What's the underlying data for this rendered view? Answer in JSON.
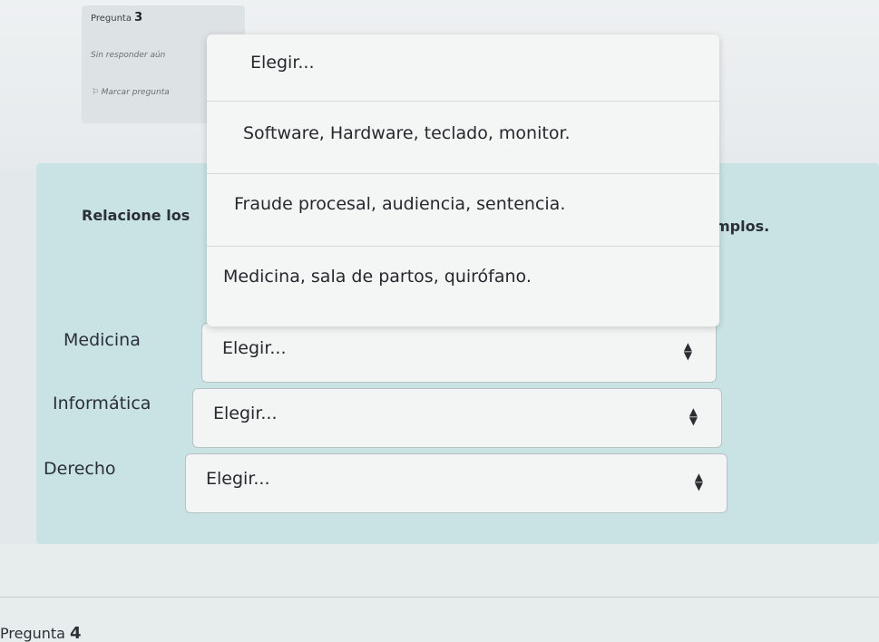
{
  "question_info": {
    "label": "Pregunta",
    "number": "3",
    "status": "Sin responder aún",
    "flag": "Marcar pregunta"
  },
  "prompt": {
    "left_text": "Relacione los",
    "right_text": "mplos."
  },
  "dropdown": {
    "options": [
      "Elegir...",
      "Software, Hardware, teclado, monitor.",
      "Fraude procesal, audiencia, sentencia.",
      "Medicina, sala de partos, quirófano."
    ]
  },
  "matches": [
    {
      "label": "Medicina",
      "value": "Elegir..."
    },
    {
      "label": "Informática",
      "value": "Elegir..."
    },
    {
      "label": "Derecho",
      "value": "Elegir..."
    }
  ],
  "next_question": {
    "label": "Pregunta",
    "number": "4"
  }
}
